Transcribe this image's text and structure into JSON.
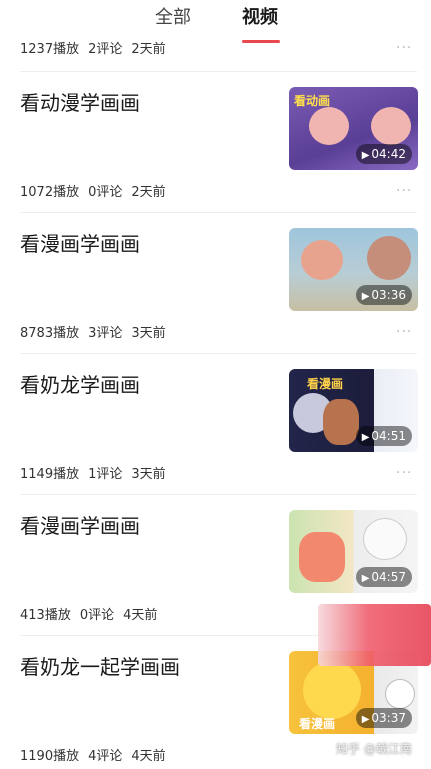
{
  "tabs": {
    "all": "全部",
    "video": "视频"
  },
  "items": [
    {
      "title": "",
      "plays": "1237播放",
      "comments": "2评论",
      "time": "2天前",
      "duration": ""
    },
    {
      "title": "看动漫学画画",
      "plays": "1072播放",
      "comments": "0评论",
      "time": "2天前",
      "duration": "04:42",
      "thumb_text": "看动画"
    },
    {
      "title": "看漫画学画画",
      "plays": "8783播放",
      "comments": "3评论",
      "time": "3天前",
      "duration": "03:36"
    },
    {
      "title": "看奶龙学画画",
      "plays": "1149播放",
      "comments": "1评论",
      "time": "3天前",
      "duration": "04:51",
      "thumb_text": "看漫画"
    },
    {
      "title": "看漫画学画画",
      "plays": "413播放",
      "comments": "0评论",
      "time": "4天前",
      "duration": "04:57"
    },
    {
      "title": "看奶龙一起学画画",
      "plays": "1190播放",
      "comments": "4评论",
      "time": "4天前",
      "duration": "03:37",
      "thumb_text": "看漫画"
    }
  ],
  "more_label": "···",
  "watermark": "知乎 @戟江南",
  "colors": {
    "accent": "#e8474e",
    "divider": "#eeeeee"
  }
}
